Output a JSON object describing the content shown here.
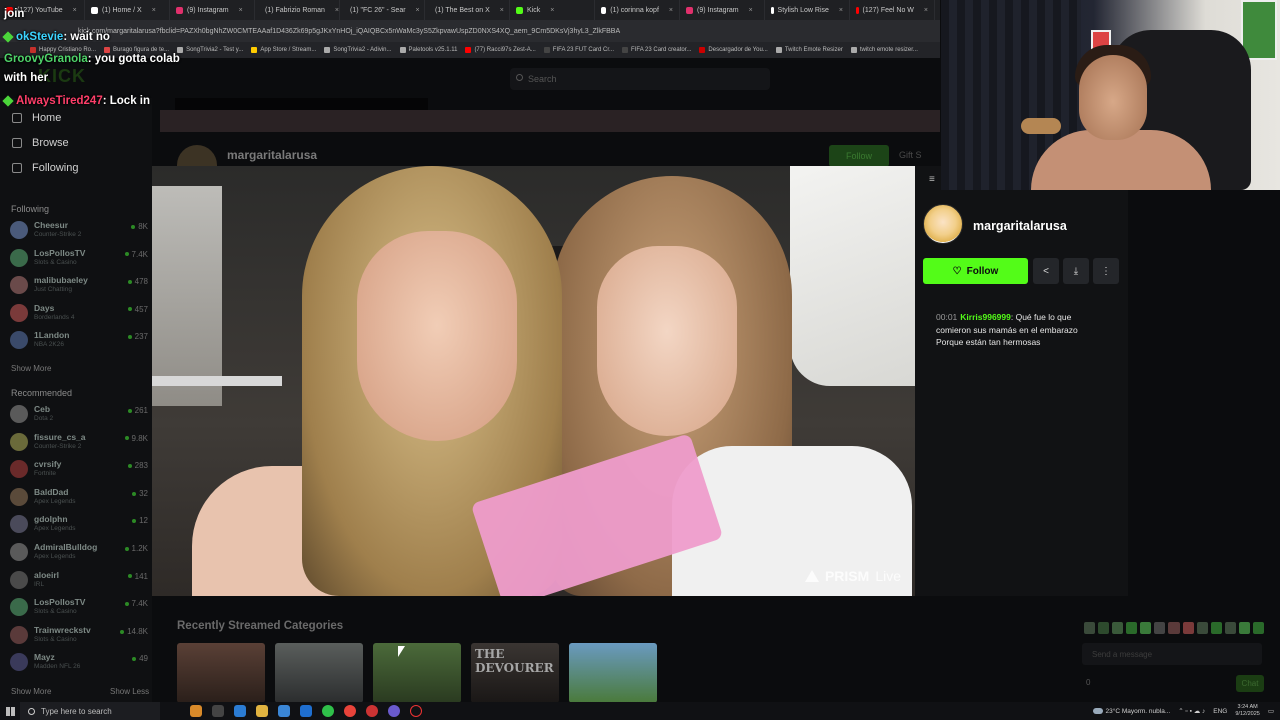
{
  "browser": {
    "tabs": [
      {
        "label": "(127) YouTube",
        "color": "#ff0000"
      },
      {
        "label": "(1) Home / X",
        "color": "#ffffff"
      },
      {
        "label": "(9) Instagram",
        "color": "#e1306c"
      },
      {
        "label": "(1) Fabrizio Roman",
        "color": "#ffffff"
      },
      {
        "label": "(1) \"FC 26\" - Sear",
        "color": "#ffffff"
      },
      {
        "label": "(1) The Best on X",
        "color": "#ffffff"
      },
      {
        "label": "Kick",
        "color": "#53fc18"
      },
      {
        "label": "(1) corinna kopf",
        "color": "#ffffff"
      },
      {
        "label": "(9) Instagram",
        "color": "#e1306c"
      },
      {
        "label": "Stylish Low Rise",
        "color": "#ffffff"
      },
      {
        "label": "(127) Feel No W",
        "color": "#ff0000"
      }
    ],
    "url": "kick.com/margaritalarusa?fbclid=PAZXh0bgNhZW0CMTEAAaf1D436Zk69p5gJKxYnHOj_iQAIQBCx5nWaMc3yS5ZkpvawUspZD0NXS4XQ_aem_9Cm5DKsVj3hyL3_ZlkFBBA",
    "bookmarks": [
      {
        "label": "Happy Cristiano Ro...",
        "color": "#c4302b"
      },
      {
        "label": "Burago figura de te...",
        "color": "#d44"
      },
      {
        "label": "SongTrivia2 - Test y...",
        "color": "#aaa"
      },
      {
        "label": "App Store / Stream...",
        "color": "#ffcc00"
      },
      {
        "label": "SongTrivia2 - Adivin...",
        "color": "#aaa"
      },
      {
        "label": "Paletools v25.1.11",
        "color": "#aaa"
      },
      {
        "label": "(77) Racci97s Zest-A...",
        "color": "#ff0000"
      },
      {
        "label": "FIFA 23 FUT Card Cr...",
        "color": "#444"
      },
      {
        "label": "FIFA 23 Card creator...",
        "color": "#444"
      },
      {
        "label": "Descargador de You...",
        "color": "#c00"
      },
      {
        "label": "Twitch Emote Resizer",
        "color": "#aaa"
      },
      {
        "label": "twitch emote resizer...",
        "color": "#aaa"
      }
    ]
  },
  "overlay_chat": [
    {
      "user": "",
      "msg": "join"
    },
    {
      "user": "okStevie",
      "msg": ": wait no"
    },
    {
      "user": "GroovyGranola",
      "msg": ": you gotta colab"
    },
    {
      "user": "",
      "msg": "with her"
    },
    {
      "user": "AlwaysTired247",
      "msg": ": Lock in"
    }
  ],
  "kick": {
    "logo": "KICK",
    "search_placeholder": "Search",
    "nav": {
      "home": "Home",
      "browse": "Browse",
      "following": "Following"
    },
    "following_title": "Following",
    "following": [
      {
        "name": "Cheesur",
        "sub": "Counter-Strike 2",
        "viewers": "8K",
        "color": "#4a5a7a"
      },
      {
        "name": "LosPollosTV",
        "sub": "Slots & Casino",
        "viewers": "7.4K",
        "color": "#3a6a4a"
      },
      {
        "name": "malibubaeley",
        "sub": "Just Chatting",
        "viewers": "478",
        "color": "#6a4a4a"
      },
      {
        "name": "Days",
        "sub": "Borderlands 4",
        "viewers": "457",
        "color": "#7a3a3a"
      },
      {
        "name": "1Landon",
        "sub": "NBA 2K26",
        "viewers": "237",
        "color": "#3a4a6a"
      }
    ],
    "show_more": "Show More",
    "recommended_title": "Recommended",
    "recommended": [
      {
        "name": "Ceb",
        "sub": "Dota 2",
        "viewers": "261",
        "color": "#5a5a5a"
      },
      {
        "name": "fissure_cs_a",
        "sub": "Counter-Strike 2",
        "viewers": "9.8K",
        "color": "#6a6a3a"
      },
      {
        "name": "cvrsify",
        "sub": "Fortnite",
        "viewers": "283",
        "color": "#6a2a2a"
      },
      {
        "name": "BaldDad",
        "sub": "Apex Legends",
        "viewers": "32",
        "color": "#5a4a3a"
      },
      {
        "name": "gdolphn",
        "sub": "Apex Legends",
        "viewers": "12",
        "color": "#4a4a5a"
      },
      {
        "name": "AdmiralBulldog",
        "sub": "Apex Legends",
        "viewers": "1.2K",
        "color": "#5a5a5a"
      },
      {
        "name": "aloeirl",
        "sub": "IRL",
        "viewers": "141",
        "color": "#4a4a4a"
      },
      {
        "name": "LosPollosTV",
        "sub": "Slots & Casino",
        "viewers": "7.4K",
        "color": "#3a6a4a"
      },
      {
        "name": "Trainwreckstv",
        "sub": "Slots & Casino",
        "viewers": "14.8K",
        "color": "#5a3a3a"
      },
      {
        "name": "Mayz",
        "sub": "Madden NFL 26",
        "viewers": "49",
        "color": "#3a3a5a"
      }
    ],
    "show_more_bottom": "Show More",
    "show_less": "Show Less",
    "streamer": "margaritalarusa",
    "follow_bg": "Follow",
    "gift": "Gift S",
    "recent_categories_title": "Recently Streamed Categories",
    "category_devourer": "THE DEVOURER",
    "chat_placeholder": "Send a message",
    "chat_points": "0",
    "chat_button": "Chat"
  },
  "video": {
    "watermark": "PRISM",
    "watermark_live": "Live"
  },
  "popup": {
    "collapse_icon": "≡",
    "streamer": "margaritalarusa",
    "follow_label": "Follow",
    "chat": {
      "time": "00:01",
      "user": "Kirris996999",
      "text": ": Qué fue lo que comieron sus mamás en el embarazo Porque están tan hermosas"
    }
  },
  "taskbar": {
    "search_placeholder": "Type here to search",
    "weather": "23°C  Mayorm. nubla...",
    "lang": "ENG",
    "time": "3:24 AM",
    "date": "9/12/2025"
  },
  "colors": {
    "kick_green": "#53fc18",
    "panel_bg": "#111214",
    "page_bg": "#0b0c0e"
  }
}
